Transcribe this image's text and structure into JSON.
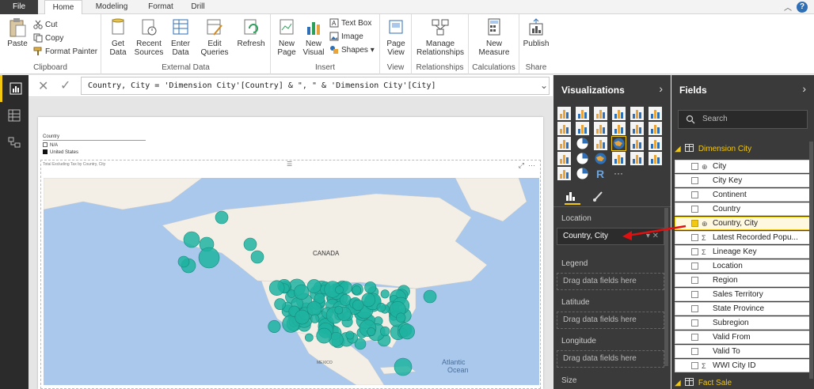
{
  "tabs": [
    {
      "label": "File"
    },
    {
      "label": "Home"
    },
    {
      "label": "Modeling"
    },
    {
      "label": "Format"
    },
    {
      "label": "Drill"
    }
  ],
  "ribbon": {
    "clipboard": {
      "paste": "Paste",
      "cut": "Cut",
      "copy": "Copy",
      "format_painter": "Format Painter",
      "label": "Clipboard"
    },
    "external_data": {
      "get_data": "Get Data",
      "recent_sources": "Recent Sources",
      "enter_data": "Enter Data",
      "edit_queries": "Edit Queries",
      "refresh": "Refresh",
      "label": "External Data"
    },
    "insert": {
      "new_page": "New Page",
      "new_visual": "New Visual",
      "text_box": "Text Box",
      "image": "Image",
      "shapes": "Shapes",
      "label": "Insert"
    },
    "view": {
      "page_view": "Page View",
      "label": "View"
    },
    "relationships": {
      "manage": "Manage Relationships",
      "label": "Relationships"
    },
    "calculations": {
      "new_measure": "New Measure",
      "label": "Calculations"
    },
    "share": {
      "publish": "Publish",
      "label": "Share"
    }
  },
  "formula": "Country, City = 'Dimension City'[Country] & \", \" & 'Dimension City'[City]",
  "canvas": {
    "slicer_title": "Country",
    "slicer_items": [
      "N/A",
      "United States"
    ],
    "map_title": "Total Excluding Tax by Country, City",
    "map_labels": {
      "canada": "CANADA",
      "atlantic1": "Atlantic",
      "atlantic2": "Ocean",
      "mexico": "MEXICO"
    }
  },
  "visualizations": {
    "title": "Visualizations",
    "wells": {
      "location_label": "Location",
      "location_value": "Country, City",
      "legend_label": "Legend",
      "legend_placeholder": "Drag data fields here",
      "latitude_label": "Latitude",
      "latitude_placeholder": "Drag data fields here",
      "longitude_label": "Longitude",
      "longitude_placeholder": "Drag data fields here",
      "size_label": "Size"
    }
  },
  "fields": {
    "title": "Fields",
    "search_placeholder": "Search",
    "table_name": "Dimension City",
    "items": [
      {
        "name": "City",
        "icon": "⊕",
        "checked": false
      },
      {
        "name": "City Key",
        "icon": "",
        "checked": false
      },
      {
        "name": "Continent",
        "icon": "",
        "checked": false
      },
      {
        "name": "Country",
        "icon": "",
        "checked": false
      },
      {
        "name": "Country, City",
        "icon": "⊕",
        "checked": true
      },
      {
        "name": "Latest Recorded Popu...",
        "icon": "Σ",
        "checked": false
      },
      {
        "name": "Lineage Key",
        "icon": "Σ",
        "checked": false
      },
      {
        "name": "Location",
        "icon": "",
        "checked": false
      },
      {
        "name": "Region",
        "icon": "",
        "checked": false
      },
      {
        "name": "Sales Territory",
        "icon": "",
        "checked": false
      },
      {
        "name": "State Province",
        "icon": "",
        "checked": false
      },
      {
        "name": "Subregion",
        "icon": "",
        "checked": false
      },
      {
        "name": "Valid From",
        "icon": "",
        "checked": false
      },
      {
        "name": "Valid To",
        "icon": "",
        "checked": false
      },
      {
        "name": "WWI City ID",
        "icon": "Σ",
        "checked": false
      }
    ],
    "next_table": "Fact Sale"
  },
  "colors": {
    "accent": "#f2c811",
    "bubble": "#1fb3a0",
    "water": "#a9c8ec",
    "land": "#f3efe6"
  }
}
